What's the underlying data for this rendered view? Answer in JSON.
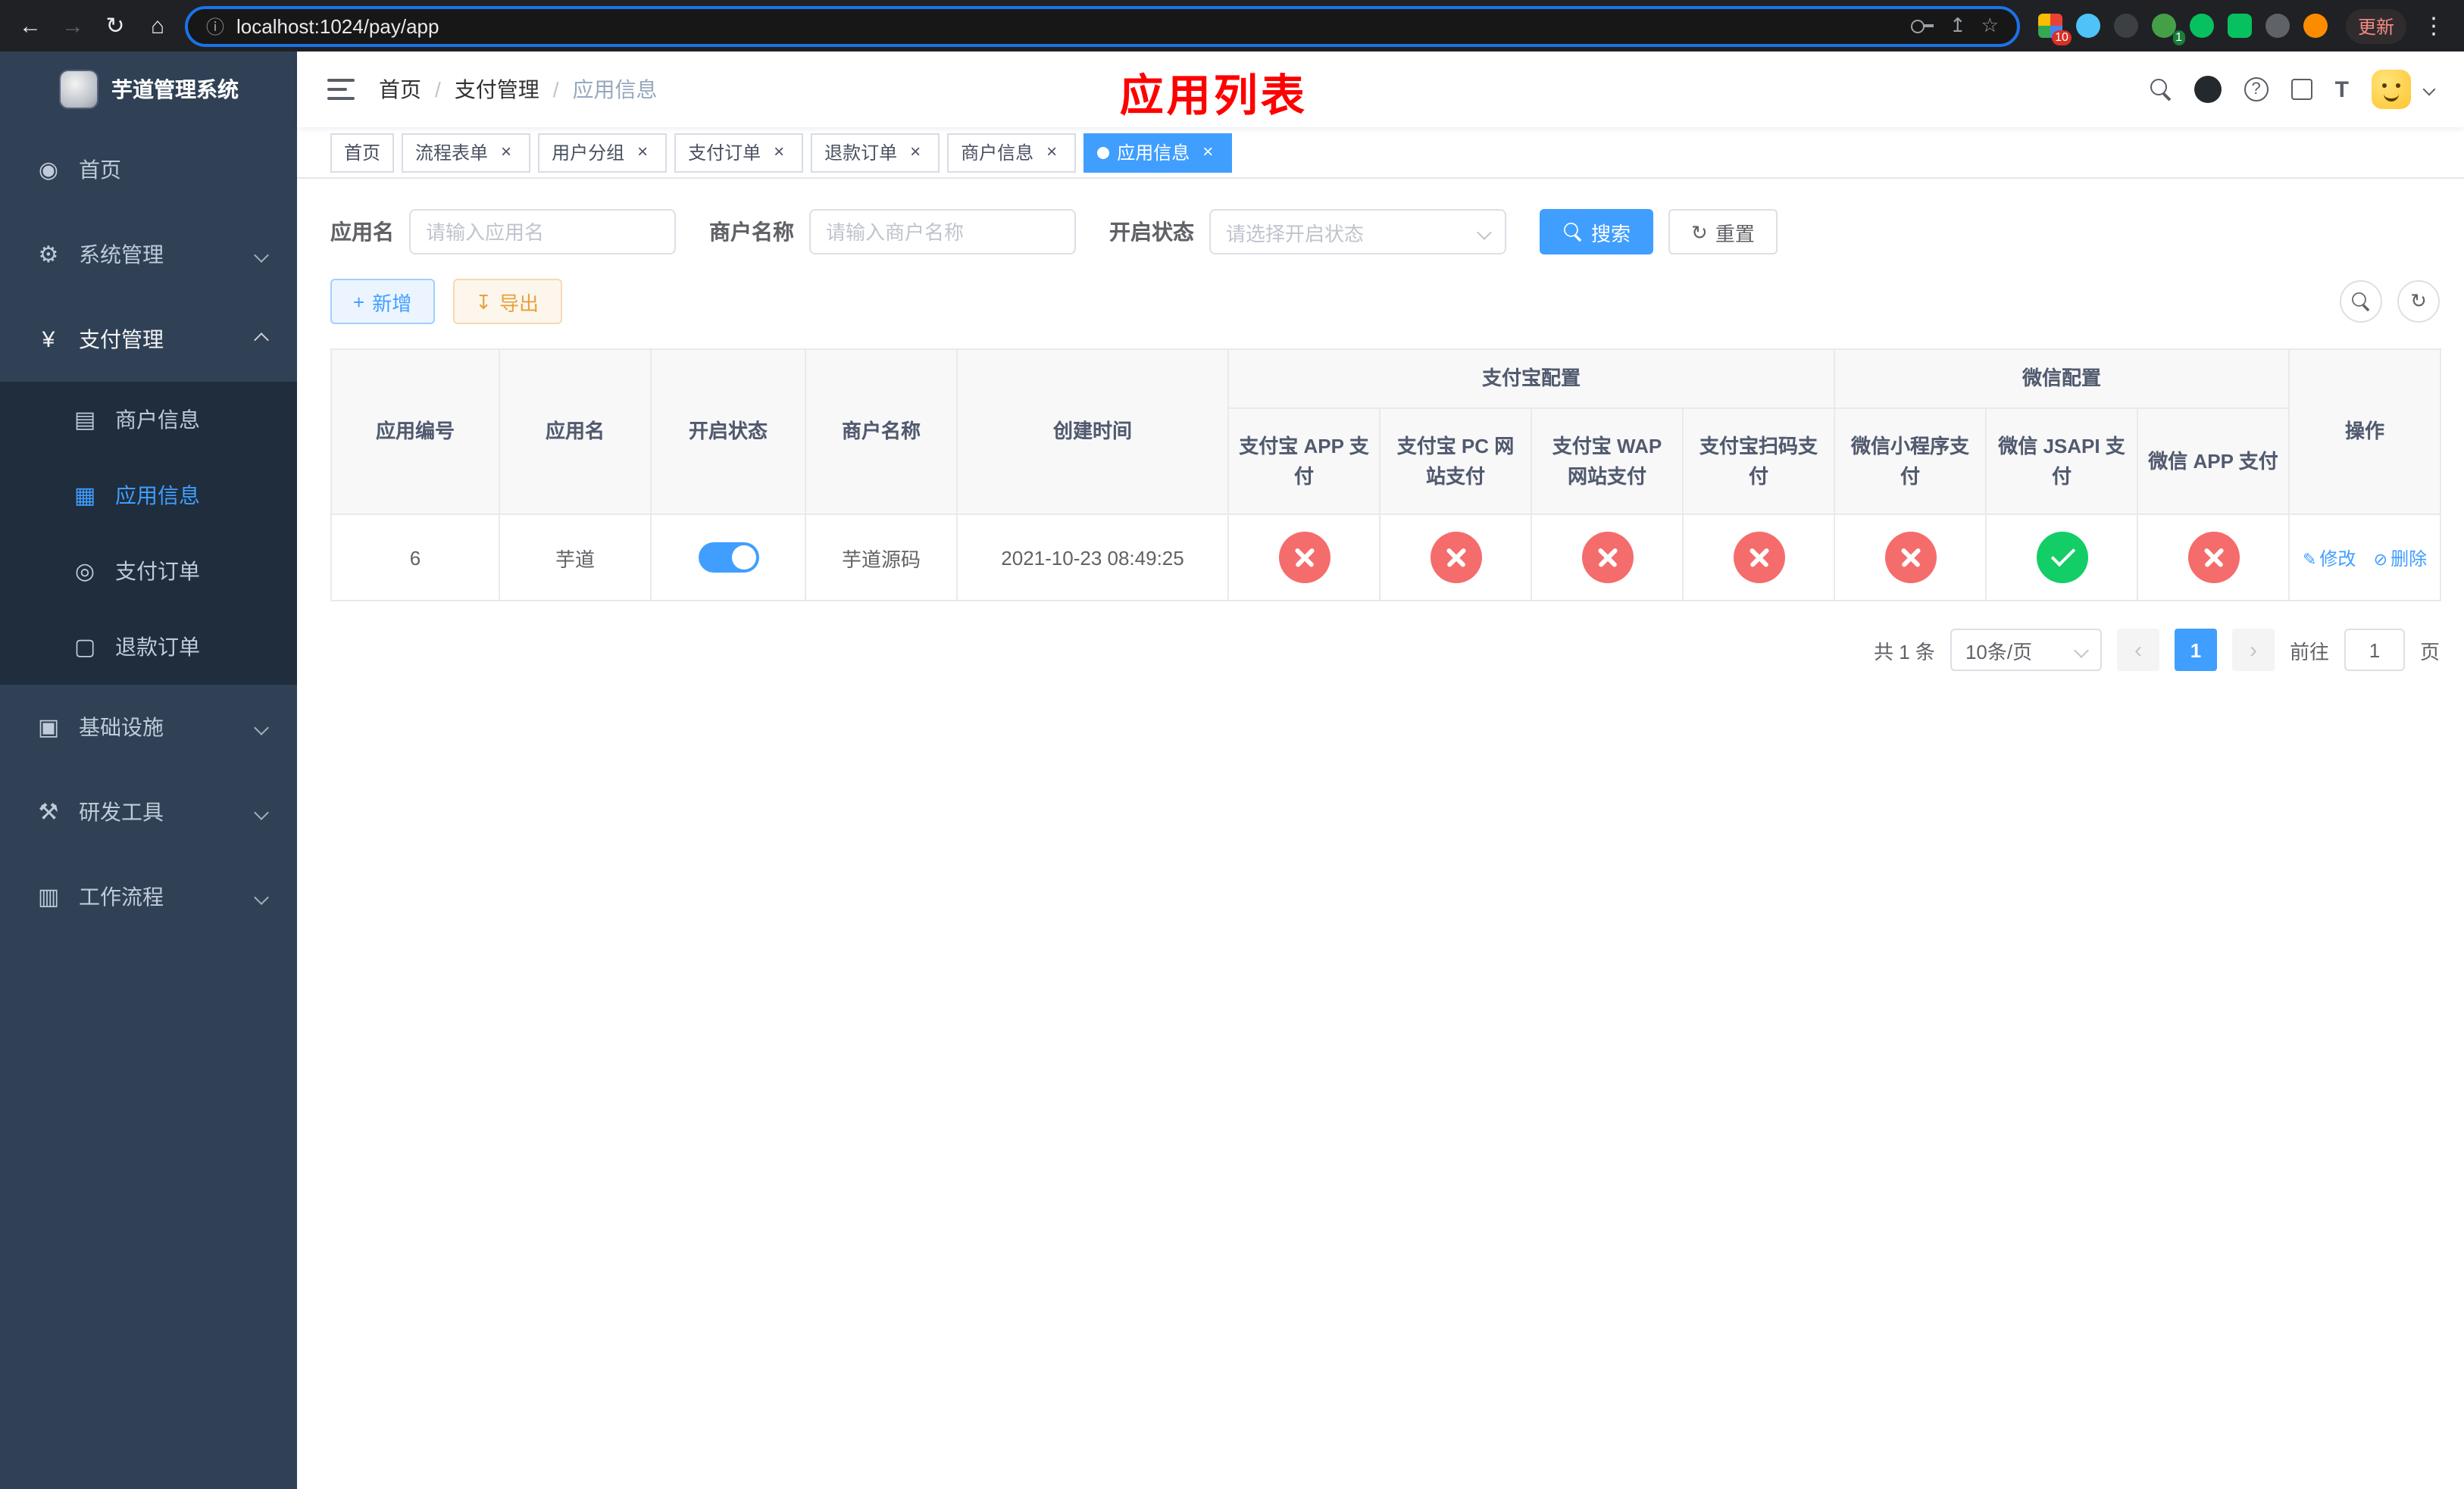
{
  "colors": {
    "primary": "#409eff",
    "danger": "#f56c6c",
    "success": "#13ce66",
    "warning": "#e6a23c",
    "sidebar_bg": "#304156",
    "submenu_bg": "#1f2d3d",
    "annotation_red": "#ff0000"
  },
  "icons": {
    "back": "←",
    "forward": "→",
    "reload": "↻",
    "home": "⌂",
    "info": "ⓘ",
    "share": "↥",
    "star": "☆",
    "more": "⋮",
    "close": "×",
    "dashboard": "◉",
    "gear": "⚙",
    "yen": "¥",
    "merchant": "▤",
    "app": "▦",
    "order": "◎",
    "refund": "▢",
    "infra": "▣",
    "tools": "⚒",
    "workflow": "▥",
    "plus": "+",
    "download": "↧",
    "refresh": "↻",
    "edit": "✎",
    "delete": "⊘",
    "prev": "‹",
    "next": "›",
    "question": "?",
    "size_big": "T",
    "size_small": "T",
    "separator": "/"
  },
  "browser": {
    "url": "localhost:1024/pay/app",
    "update_label": "更新",
    "ext_badge_1": "10",
    "ext_badge_2": "1"
  },
  "sidebar": {
    "title": "芋道管理系统",
    "items": [
      {
        "label": "首页"
      },
      {
        "label": "系统管理"
      },
      {
        "label": "支付管理"
      },
      {
        "label": "基础设施"
      },
      {
        "label": "研发工具"
      },
      {
        "label": "工作流程"
      }
    ],
    "payment_submenu": [
      {
        "label": "商户信息"
      },
      {
        "label": "应用信息"
      },
      {
        "label": "支付订单"
      },
      {
        "label": "退款订单"
      }
    ]
  },
  "header": {
    "breadcrumb": [
      {
        "label": "首页"
      },
      {
        "label": "支付管理"
      },
      {
        "label": "应用信息"
      }
    ],
    "overlay_title": "应用列表"
  },
  "tabs": [
    {
      "label": "首页"
    },
    {
      "label": "流程表单"
    },
    {
      "label": "用户分组"
    },
    {
      "label": "支付订单"
    },
    {
      "label": "退款订单"
    },
    {
      "label": "商户信息"
    },
    {
      "label": "应用信息"
    }
  ],
  "filters": {
    "app_name_label": "应用名",
    "app_name_placeholder": "请输入应用名",
    "merchant_label": "商户名称",
    "merchant_placeholder": "请输入商户名称",
    "status_label": "开启状态",
    "status_placeholder": "请选择开启状态",
    "search_label": "搜索",
    "reset_label": "重置"
  },
  "toolbar": {
    "add_label": "新增",
    "export_label": "导出"
  },
  "table": {
    "columns": {
      "app_id": "应用编号",
      "app_name": "应用名",
      "status": "开启状态",
      "merchant": "商户名称",
      "created": "创建时间",
      "alipay_group": "支付宝配置",
      "wechat_group": "微信配置",
      "alipay_app": "支付宝 APP 支付",
      "alipay_pc": "支付宝 PC 网站支付",
      "alipay_wap": "支付宝 WAP 网站支付",
      "alipay_qr": "支付宝扫码支付",
      "wx_mini": "微信小程序支付",
      "wx_jsapi": "微信 JSAPI 支付",
      "wx_app": "微信 APP 支付",
      "actions": "操作"
    },
    "rows": [
      {
        "app_id": "6",
        "app_name": "芋道",
        "enabled": true,
        "merchant": "芋道源码",
        "created": "2021-10-23 08:49:25",
        "alipay_app": "no",
        "alipay_pc": "no",
        "alipay_wap": "no",
        "alipay_qr": "no",
        "wx_mini": "no",
        "wx_jsapi": "yes",
        "wx_app": "no",
        "edit_label": "修改",
        "delete_label": "删除"
      }
    ]
  },
  "pagination": {
    "total": "共 1 条",
    "page_size": "10条/页",
    "page": "1",
    "goto_prefix": "前往",
    "goto_value": "1",
    "goto_suffix": "页"
  }
}
